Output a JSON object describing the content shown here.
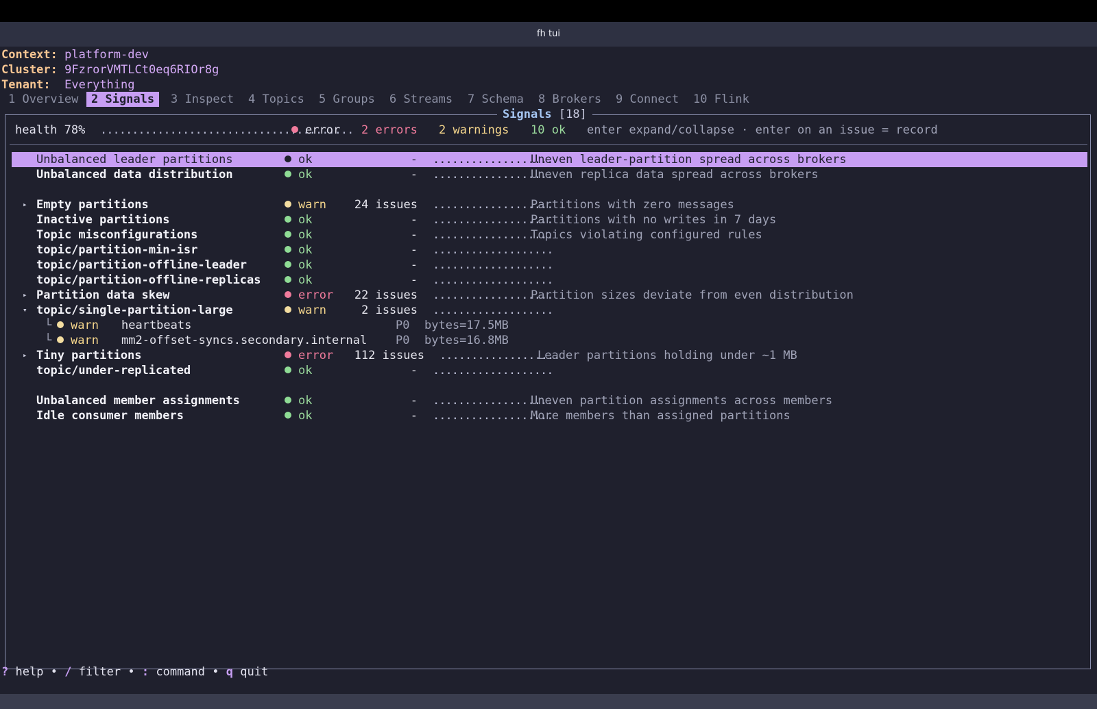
{
  "window": {
    "title": "fh tui"
  },
  "context": {
    "label": "Context:",
    "value": "platform-dev"
  },
  "cluster": {
    "label": "Cluster:",
    "value": "9FzrorVMTLCt0eq6RIOr8g"
  },
  "tenant": {
    "label": "Tenant:",
    "value": "Everything"
  },
  "tabs": [
    {
      "label": "1 Overview",
      "active": false
    },
    {
      "label": "2 Signals",
      "active": true
    },
    {
      "label": "3 Inspect",
      "active": false
    },
    {
      "label": "4 Topics",
      "active": false
    },
    {
      "label": "5 Groups",
      "active": false
    },
    {
      "label": "6 Streams",
      "active": false
    },
    {
      "label": "7 Schema",
      "active": false
    },
    {
      "label": "8 Brokers",
      "active": false
    },
    {
      "label": "9 Connect",
      "active": false
    },
    {
      "label": "10 Flink",
      "active": false
    }
  ],
  "panel": {
    "title": "Signals",
    "count": "[18]"
  },
  "summary": {
    "health": "health 78%",
    "health_bar": "........................................",
    "status": "error",
    "errors": "2 errors",
    "warnings": "2 warnings",
    "ok": "10 ok",
    "hint": "enter expand/collapse · enter on an issue = record"
  },
  "rows": [
    {
      "name": "Unbalanced leader partitions",
      "status": "ok",
      "count": "-",
      "spark": "...................",
      "desc": "Uneven leader-partition spread across brokers",
      "selected": true
    },
    {
      "name": "Unbalanced data distribution",
      "status": "ok",
      "count": "-",
      "spark": "...................",
      "desc": "Uneven replica data spread across brokers"
    },
    {
      "name": "Empty partitions",
      "status": "warn",
      "count": "24 issues",
      "spark": "...................",
      "desc": "Partitions with zero messages",
      "arrow": "▸"
    },
    {
      "name": "Inactive partitions",
      "status": "ok",
      "count": "-",
      "spark": "...................",
      "desc": "Partitions with no writes in 7 days"
    },
    {
      "name": "Topic misconfigurations",
      "status": "ok",
      "count": "-",
      "spark": "...................",
      "desc": "Topics violating configured rules"
    },
    {
      "name": "topic/partition-min-isr",
      "status": "ok",
      "count": "-",
      "spark": "...................",
      "desc": ""
    },
    {
      "name": "topic/partition-offline-leader",
      "status": "ok",
      "count": "-",
      "spark": "...................",
      "desc": ""
    },
    {
      "name": "topic/partition-offline-replicas",
      "status": "ok",
      "count": "-",
      "spark": "...................",
      "desc": ""
    },
    {
      "name": "Partition data skew",
      "status": "error",
      "count": "22 issues",
      "spark": "...................",
      "desc": "Partition sizes deviate from even distribution",
      "arrow": "▸"
    },
    {
      "name": "topic/single-partition-large",
      "status": "warn",
      "count": "2 issues",
      "spark": "...................",
      "desc": "",
      "arrow": "▾"
    },
    {
      "name": "Tiny partitions",
      "status": "error",
      "count": "112 issues",
      "spark": "...................",
      "desc": "Leader partitions holding under ~1 MB",
      "arrow": "▸"
    },
    {
      "name": "topic/under-replicated",
      "status": "ok",
      "count": "-",
      "spark": "...................",
      "desc": ""
    },
    {
      "name": "Unbalanced member assignments",
      "status": "ok",
      "count": "-",
      "spark": "...................",
      "desc": "Uneven partition assignments across members"
    },
    {
      "name": "Idle consumer members",
      "status": "ok",
      "count": "-",
      "spark": "...................",
      "desc": "More members than assigned partitions"
    }
  ],
  "issues": [
    {
      "tree": "└",
      "status": "warn",
      "topic": "heartbeats",
      "partition": "P0",
      "size": "bytes=17.5MB"
    },
    {
      "tree": "└",
      "status": "warn",
      "topic": "mm2-offset-syncs.secondary.internal",
      "partition": "P0",
      "size": "bytes=16.8MB"
    }
  ],
  "footer": {
    "help_key": "?",
    "help": "help",
    "filter_key": "/",
    "filter": "filter",
    "cmd_key": ":",
    "cmd": "command",
    "quit_key": "q",
    "quit": "quit",
    "sep": "•"
  }
}
